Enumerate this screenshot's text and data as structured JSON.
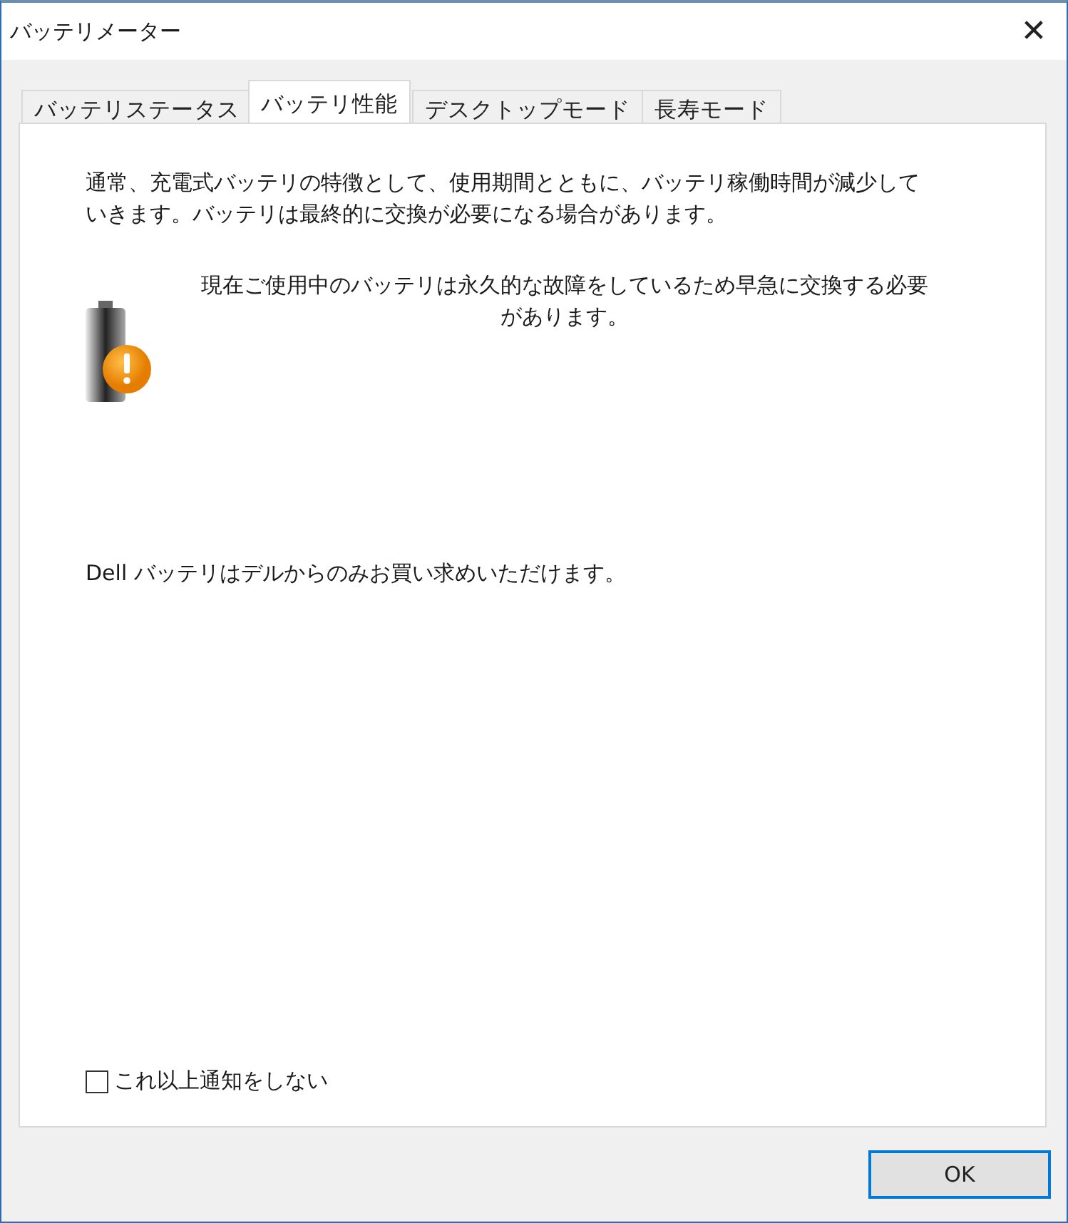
{
  "window": {
    "title": "バッテリメーター",
    "close": "✕"
  },
  "tabs": [
    {
      "label": "バッテリステータス",
      "selected": false
    },
    {
      "label": "バッテリ性能",
      "selected": true
    },
    {
      "label": "デスクトップモード",
      "selected": false
    },
    {
      "label": "長寿モード",
      "selected": false
    }
  ],
  "panel": {
    "intro": "通常、充電式バッテリの特徴として、使用期間とともに、バッテリ稼働時間が減少していきます。バッテリは最終的に交換が必要になる場合があります。",
    "warning": "現在ご使用中のバッテリは永久的な故障をしているため早急に交換する必要があります。",
    "note": "Dell バッテリはデルからのみお買い求めいただけます。",
    "checkbox": {
      "label": "これ以上通知をしない",
      "checked": false
    }
  },
  "buttons": [
    {
      "label": "OK"
    }
  ]
}
